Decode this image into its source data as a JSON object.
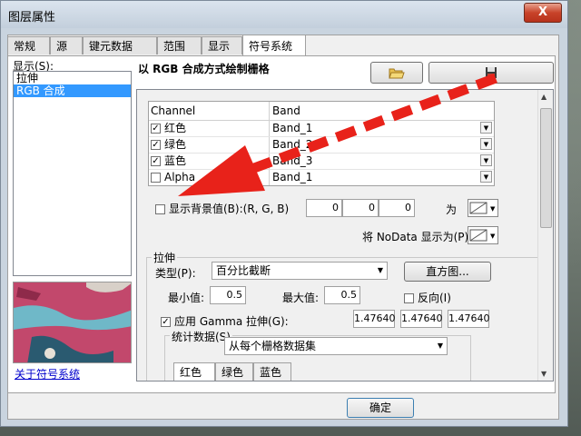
{
  "window": {
    "title": "图层属性",
    "close_label": "X"
  },
  "tabs": [
    {
      "label": "常规"
    },
    {
      "label": "源"
    },
    {
      "label": "键元数据"
    },
    {
      "label": "范围"
    },
    {
      "label": "显示"
    },
    {
      "label": "符号系统",
      "active": true
    }
  ],
  "sidebar": {
    "label": "显示(S):",
    "items": [
      {
        "label": "拉伸",
        "selected": false
      },
      {
        "label": "RGB 合成",
        "selected": true
      }
    ],
    "about_link": "关于符号系统"
  },
  "main": {
    "header_title": "以 RGB 合成方式绘制栅格"
  },
  "band_table": {
    "headers": {
      "channel": "Channel",
      "band": "Band"
    },
    "rows": [
      {
        "channel": "红色",
        "band": "Band_1",
        "checked": true
      },
      {
        "channel": "绿色",
        "band": "Band_2",
        "checked": true
      },
      {
        "channel": "蓝色",
        "band": "Band_3",
        "checked": true
      },
      {
        "channel": "Alpha",
        "band": "Band_1",
        "checked": false
      }
    ]
  },
  "background": {
    "label": "显示背景值(B):(R, G, B)",
    "checked": false,
    "r": "0",
    "g": "0",
    "b": "0",
    "as_label": "为",
    "nodata_label": "将 NoData 显示为(P)"
  },
  "stretch": {
    "group_label": "拉伸",
    "type_label": "类型(P):",
    "type_value": "百分比截断",
    "histogram_button": "直方图...",
    "min_label": "最小值:",
    "min_value": "0.5",
    "max_label": "最大值:",
    "max_value": "0.5",
    "invert_label": "反向(I)",
    "invert_checked": false,
    "gamma_label": "应用 Gamma 拉伸(G):",
    "gamma_checked": true,
    "gamma_values": [
      "1.47640",
      "1.47640",
      "1.47640"
    ],
    "stats_label": "统计数据(S)",
    "stats_value": "从每个栅格数据集",
    "stat_tabs": [
      "红色",
      "绿色",
      "蓝色"
    ]
  },
  "footer": {
    "ok_label": "确定"
  },
  "annotation": {
    "arrow_color": "#e8221a"
  },
  "colors": {
    "selection": "#3399ff",
    "link": "#0000cc"
  }
}
